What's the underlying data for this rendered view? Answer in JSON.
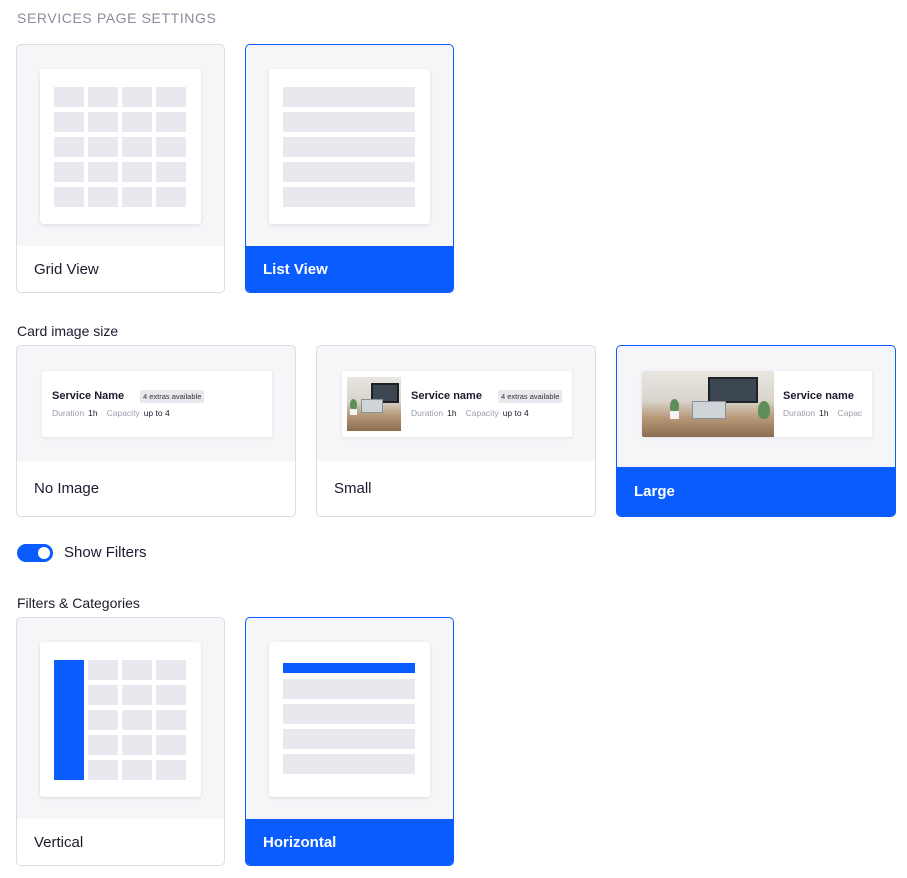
{
  "page": {
    "section_title": "SERVICES PAGE SETTINGS",
    "accent_color": "#0a5cff"
  },
  "layout_options": {
    "items": [
      {
        "label": "Grid View",
        "selected": false
      },
      {
        "label": "List View",
        "selected": true
      }
    ]
  },
  "card_image_size": {
    "label": "Card image size",
    "items": [
      {
        "label": "No Image",
        "selected": false
      },
      {
        "label": "Small",
        "selected": false
      },
      {
        "label": "Large",
        "selected": true
      }
    ],
    "previews": [
      {
        "name": "Service Name",
        "badge": "4 extras available",
        "duration_label": "Duration",
        "duration_value": "1h",
        "capacity_label": "Capacity",
        "capacity_value": "up to 4"
      },
      {
        "name": "Service name",
        "badge": "4 extras available",
        "duration_label": "Duration",
        "duration_value": "1h",
        "capacity_label": "Capacity",
        "capacity_value": "up to 4"
      },
      {
        "name": "Service name",
        "duration_label": "Duration",
        "duration_value": "1h",
        "capacity_label": "Capac"
      }
    ]
  },
  "show_filters": {
    "label": "Show Filters",
    "enabled": true
  },
  "filters_categories": {
    "label": "Filters & Categories",
    "items": [
      {
        "label": "Vertical",
        "selected": false
      },
      {
        "label": "Horizontal",
        "selected": true
      }
    ]
  }
}
